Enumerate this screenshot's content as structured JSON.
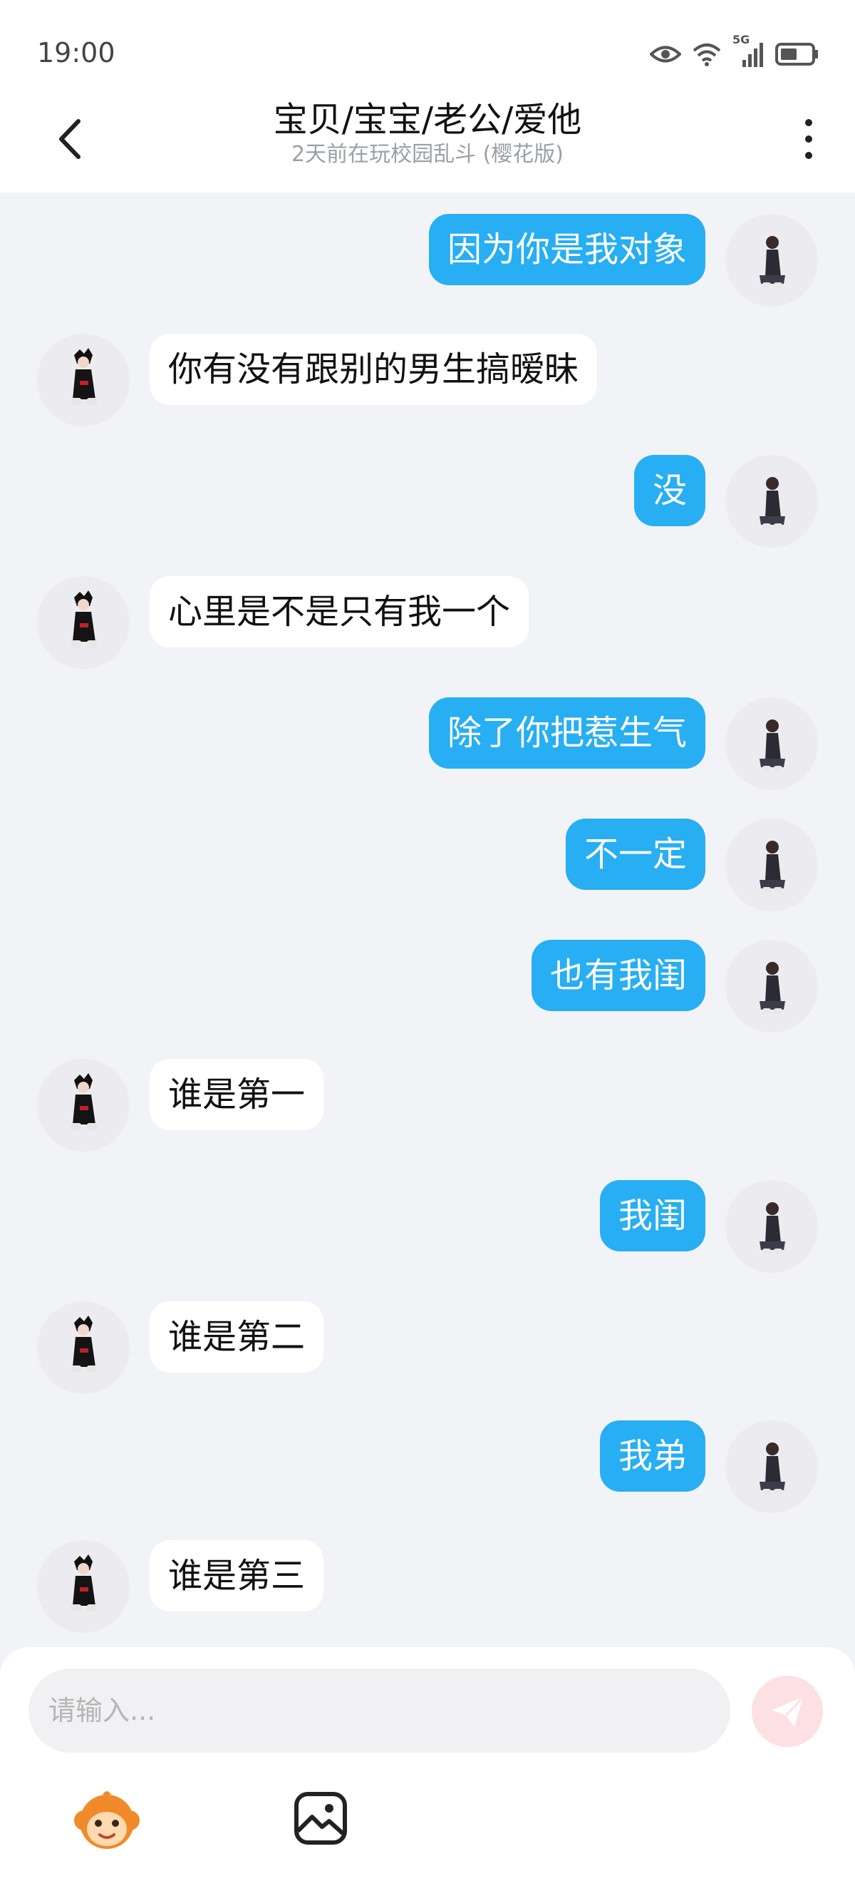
{
  "status": {
    "time": "19:00",
    "network": "5G"
  },
  "header": {
    "title": "宝贝/宝宝/老公/爱他",
    "subtitle": "2天前在玩校园乱斗 (樱花版)"
  },
  "messages": [
    {
      "side": "me",
      "text": "因为你是我对象"
    },
    {
      "side": "other",
      "text": "你有没有跟别的男生搞暧昧"
    },
    {
      "side": "me",
      "text": "没"
    },
    {
      "side": "other",
      "text": "心里是不是只有我一个"
    },
    {
      "side": "me",
      "text": "除了你把惹生气"
    },
    {
      "side": "me",
      "text": "不一定"
    },
    {
      "side": "me",
      "text": "也有我闺"
    },
    {
      "side": "other",
      "text": "谁是第一"
    },
    {
      "side": "me",
      "text": "我闺"
    },
    {
      "side": "other",
      "text": "谁是第二"
    },
    {
      "side": "me",
      "text": "我弟"
    },
    {
      "side": "other",
      "text": "谁是第三"
    }
  ],
  "composer": {
    "placeholder": "请输入..."
  },
  "colors": {
    "outgoing": "#27aef3",
    "incoming": "#ffffff",
    "background": "#f1f3f7",
    "send": "#f7b3bb"
  }
}
